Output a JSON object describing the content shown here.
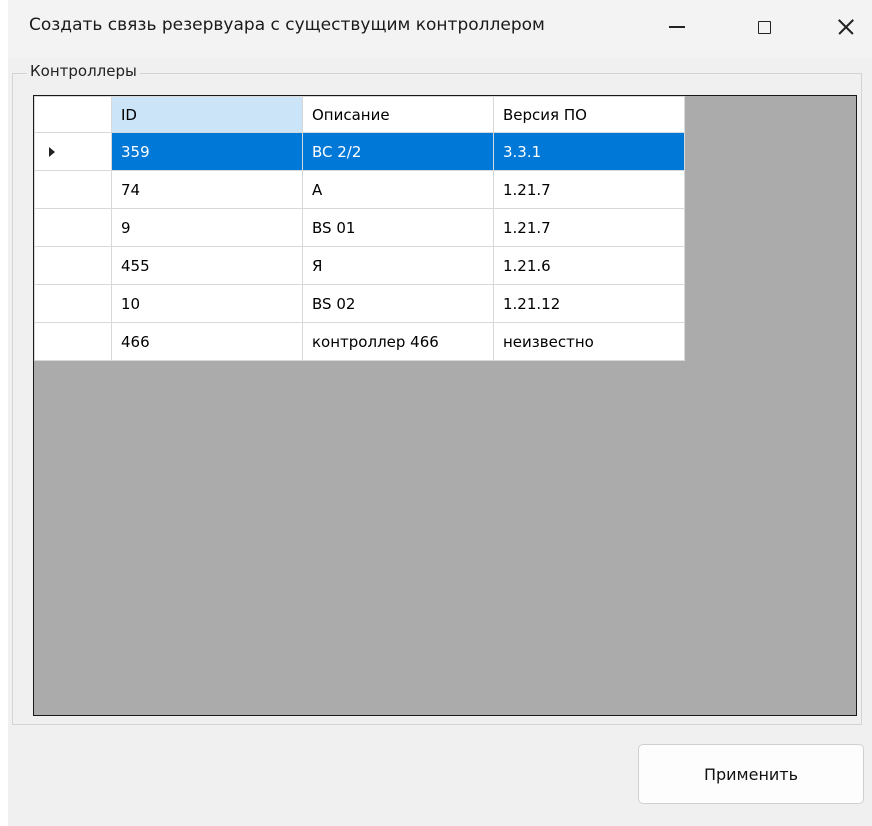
{
  "window": {
    "title": "Создать связь резервуара с существущим контроллером",
    "min_icon": "minimize-icon",
    "max_icon": "maximize-icon",
    "close_icon": "close-icon"
  },
  "group": {
    "label": "Контроллеры"
  },
  "grid": {
    "columns": [
      "ID",
      "Описание",
      "Версия ПО"
    ],
    "rows": [
      {
        "id": "359",
        "description": "BC 2/2",
        "version": "3.3.1",
        "selected": true
      },
      {
        "id": "74",
        "description": "A",
        "version": "1.21.7"
      },
      {
        "id": "9",
        "description": "BS 01",
        "version": "1.21.7"
      },
      {
        "id": "455",
        "description": "Я",
        "version": "1.21.6"
      },
      {
        "id": "10",
        "description": "BS 02",
        "version": "1.21.12"
      },
      {
        "id": "466",
        "description": "контроллер 466",
        "version": "неизвестно"
      }
    ],
    "selection_color": "#0078d7",
    "sorted_header_color": "#cce4f7",
    "empty_area_color": "#ababab"
  },
  "actions": {
    "apply_label": "Применить"
  }
}
